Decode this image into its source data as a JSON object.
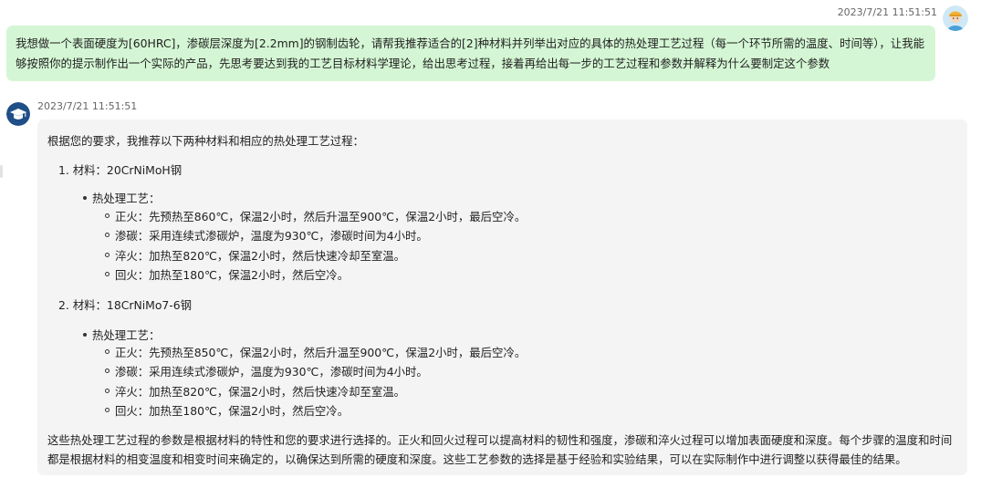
{
  "user_message": {
    "timestamp": "2023/7/21 11:51:51",
    "text": "我想做一个表面硬度为[60HRC]，渗碳层深度为[2.2mm]的钢制齿轮，请帮我推荐适合的[2]种材料并列举出对应的具体的热处理工艺过程（每一个环节所需的温度、时间等），让我能够按照你的提示制作出一个实际的产品，先思考要达到我的工艺目标材料学理论，给出思考过程，接着再给出每一步的工艺过程和参数并解释为什么要制定这个参数",
    "avatar_icon": "user-avatar-icon"
  },
  "bot_message": {
    "timestamp": "2023/7/21 11:51:51",
    "avatar_icon": "graduation-cap-icon",
    "intro": "根据您的要求，我推荐以下两种材料和相应的热处理工艺过程：",
    "materials": [
      {
        "title": "1. 材料：20CrNiMoH钢",
        "section_label": "热处理工艺：",
        "steps": [
          "正火：先预热至860℃，保温2小时，然后升温至900℃，保温2小时，最后空冷。",
          "渗碳：采用连续式渗碳炉，温度为930℃，渗碳时间为4小时。",
          "淬火：加热至820℃，保温2小时，然后快速冷却至室温。",
          "回火：加热至180℃，保温2小时，然后空冷。"
        ]
      },
      {
        "title": "2. 材料：18CrNiMo7-6钢",
        "section_label": "热处理工艺：",
        "steps": [
          "正火：先预热至850℃，保温2小时，然后升温至900℃，保温2小时，最后空冷。",
          "渗碳：采用连续式渗碳炉，温度为930℃，渗碳时间为4小时。",
          "淬火：加热至820℃，保温2小时，然后快速冷却至室温。",
          "回火：加热至180℃，保温2小时，然后空冷。"
        ]
      }
    ],
    "conclusion": "这些热处理工艺过程的参数是根据材料的特性和您的要求进行选择的。正火和回火过程可以提高材料的韧性和强度，渗碳和淬火过程可以增加表面硬度和深度。每个步骤的温度和时间都是根据材料的相变温度和相变时间来确定的，以确保达到所需的硬度和深度。这些工艺参数的选择是基于经验和实验结果，可以在实际制作中进行调整以获得最佳的结果。"
  },
  "colors": {
    "user_bubble_bg": "#d4f6d4",
    "bot_bubble_bg": "#f4f4f5",
    "bot_avatar_bg": "#1f4f87",
    "user_avatar_bg": "#cfe8f6"
  }
}
